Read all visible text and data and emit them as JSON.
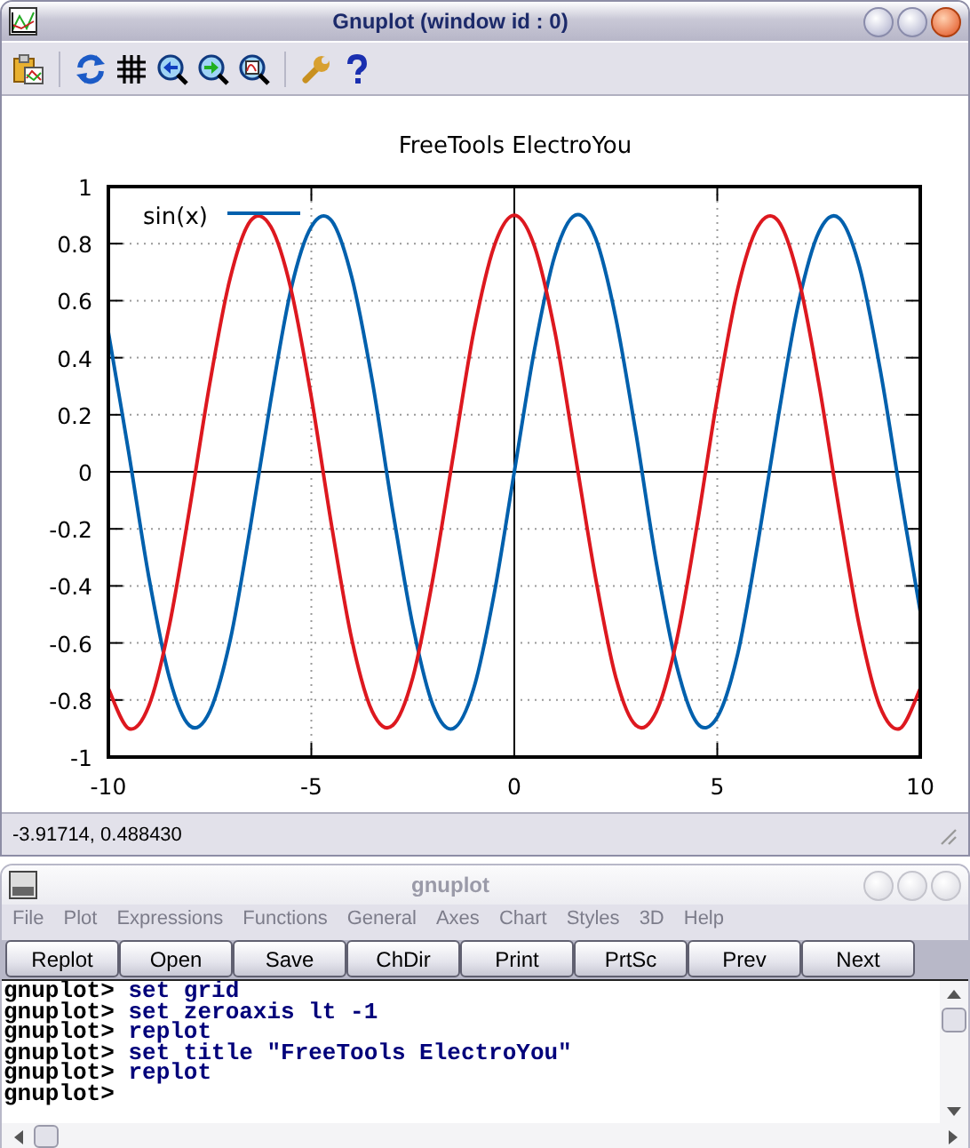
{
  "plot_window": {
    "title": "Gnuplot (window id : 0)",
    "active": true,
    "chart_data": {
      "type": "line",
      "title": "FreeTools ElectroYou",
      "x": [
        -10,
        -9.5,
        -9,
        -8.5,
        -8,
        -7.5,
        -7,
        -6.5,
        -6,
        -5.5,
        -5,
        -4.5,
        -4,
        -3.5,
        -3,
        -2.5,
        -2,
        -1.5,
        -1,
        -0.5,
        0,
        0.5,
        1,
        1.5,
        2,
        2.5,
        3,
        3.5,
        4,
        4.5,
        5,
        5.5,
        6,
        6.5,
        7,
        7.5,
        8,
        8.5,
        9,
        9.5,
        10
      ],
      "series": [
        {
          "name": "sin(x)",
          "color": "#0060ad",
          "values": [
            0.49,
            0.07,
            -0.37,
            -0.72,
            -0.89,
            -0.84,
            -0.59,
            -0.19,
            0.25,
            0.64,
            0.86,
            0.88,
            0.68,
            0.32,
            -0.13,
            -0.54,
            -0.82,
            -0.9,
            -0.76,
            -0.43,
            0,
            0.43,
            0.76,
            0.9,
            0.82,
            0.54,
            0.13,
            -0.32,
            -0.68,
            -0.88,
            -0.86,
            -0.64,
            -0.25,
            0.19,
            0.59,
            0.84,
            0.89,
            0.72,
            0.37,
            -0.07,
            -0.49
          ]
        },
        {
          "color": "#dd181f",
          "values": [
            -0.76,
            -0.9,
            -0.82,
            -0.54,
            -0.13,
            0.31,
            0.68,
            0.88,
            0.86,
            0.64,
            0.26,
            -0.19,
            -0.59,
            -0.84,
            -0.89,
            -0.72,
            -0.37,
            0.06,
            0.49,
            0.79,
            0.9,
            0.79,
            0.49,
            0.06,
            -0.37,
            -0.72,
            -0.89,
            -0.84,
            -0.59,
            -0.19,
            0.26,
            0.64,
            0.86,
            0.88,
            0.68,
            0.31,
            -0.13,
            -0.54,
            -0.82,
            -0.9,
            -0.76
          ]
        }
      ],
      "grid": true,
      "xlim": [
        -10,
        10
      ],
      "ylim": [
        -1,
        1
      ],
      "xticks": [
        -10,
        -5,
        0,
        5,
        10
      ],
      "yticks": [
        1,
        {
          "value": 0.8,
          "label": "0.8"
        },
        {
          "value": 0.6,
          "label": "0.6"
        },
        {
          "value": 0.4,
          "label": "0.4"
        },
        {
          "value": 0.2,
          "label": "0.2"
        },
        0,
        {
          "value": -0.2,
          "label": "-0.2"
        },
        {
          "value": -0.4,
          "label": "-0.4"
        },
        {
          "value": -0.6,
          "label": "-0.6"
        },
        {
          "value": -0.8,
          "label": "-0.8"
        },
        -1
      ]
    },
    "status_bar": "-3.91714, 0.488430"
  },
  "console_window": {
    "title": "gnuplot",
    "active": false,
    "menu": [
      "File",
      "Plot",
      "Expressions",
      "Functions",
      "General",
      "Axes",
      "Chart",
      "Styles",
      "3D",
      "Help"
    ],
    "buttons": [
      "Replot",
      "Open",
      "Save",
      "ChDir",
      "Print",
      "PrtSc",
      "Prev",
      "Next"
    ],
    "lines": [
      {
        "prompt": "gnuplot>",
        "command": "set grid"
      },
      {
        "prompt": "gnuplot>",
        "command": "set zeroaxis lt -1"
      },
      {
        "prompt": "gnuplot>",
        "command": "replot"
      },
      {
        "prompt": "gnuplot>",
        "command": "set title \"FreeTools ElectroYou\""
      },
      {
        "prompt": "gnuplot>",
        "command": "replot"
      },
      {
        "prompt": "gnuplot>"
      }
    ]
  }
}
